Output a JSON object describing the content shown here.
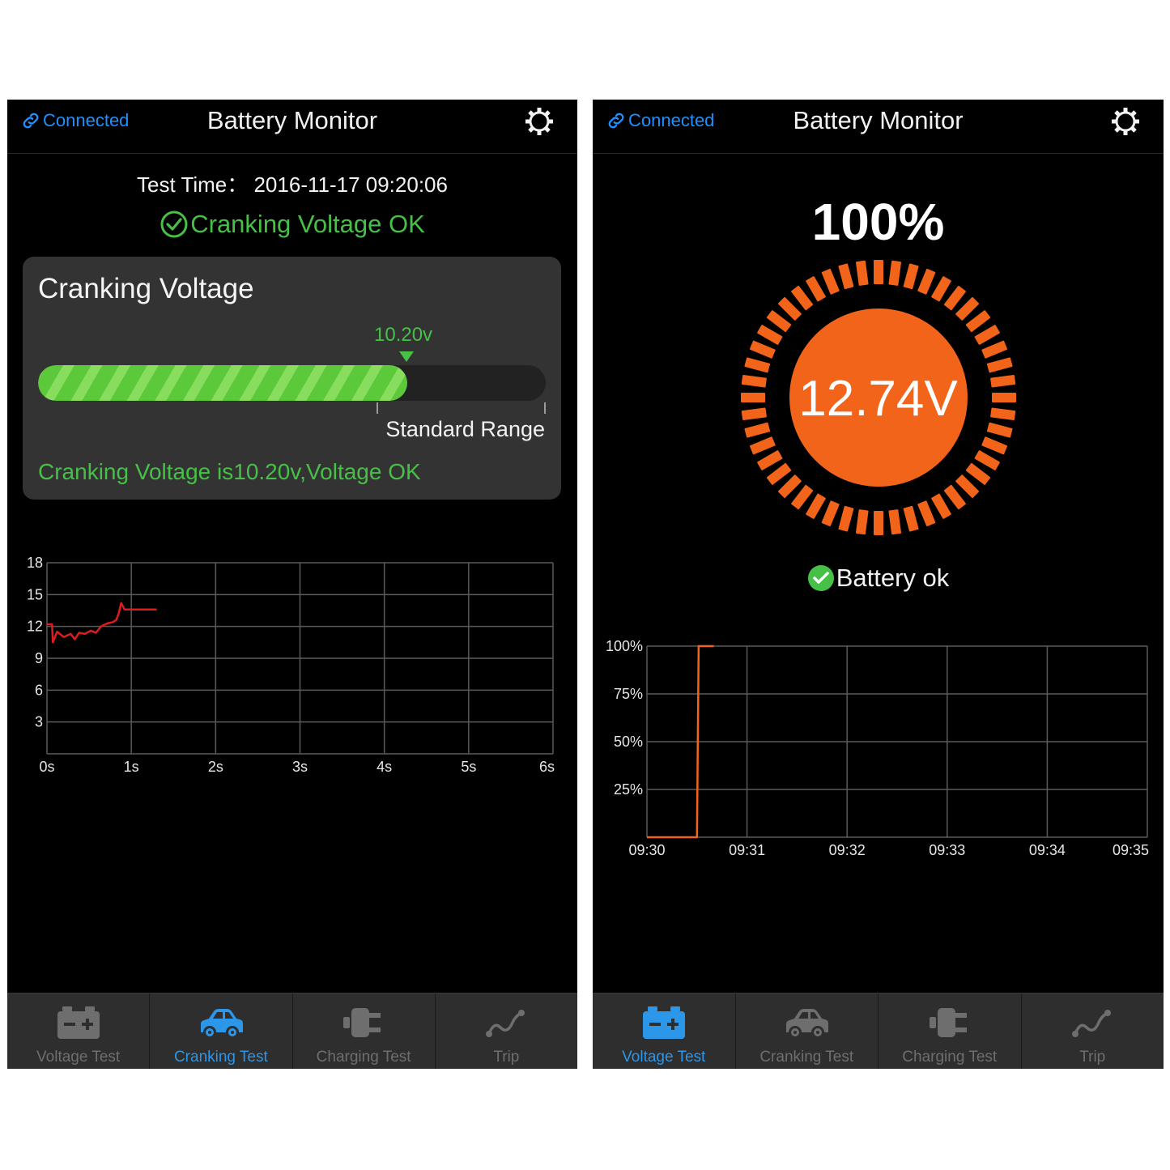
{
  "screens": [
    {
      "navbar": {
        "connected_label": "Connected",
        "title": "Battery Monitor"
      },
      "test_time": "Test Time： 2016-11-17 09:20:06",
      "status_text": "Cranking Voltage OK",
      "panel": {
        "title": "Cranking Voltage",
        "marker_value": "10.20v",
        "fill_fraction": 0.727,
        "range_label": "Standard Range",
        "message": "Cranking Voltage is10.20v,Voltage OK"
      },
      "tabs": [
        {
          "label": "Voltage Test",
          "icon": "battery-icon",
          "active": false
        },
        {
          "label": "Cranking Test",
          "icon": "car-icon",
          "active": true
        },
        {
          "label": "Charging Test",
          "icon": "plug-icon",
          "active": false
        },
        {
          "label": "Trip",
          "icon": "trip-route-icon",
          "active": false
        }
      ]
    },
    {
      "navbar": {
        "connected_label": "Connected",
        "title": "Battery Monitor"
      },
      "percent": "100%",
      "gauge_value": "12.74V",
      "gauge_level": 1.0,
      "status_text": "Battery ok",
      "tabs": [
        {
          "label": "Voltage Test",
          "icon": "battery-icon",
          "active": true
        },
        {
          "label": "Cranking Test",
          "icon": "car-icon",
          "active": false
        },
        {
          "label": "Charging Test",
          "icon": "plug-icon",
          "active": false
        },
        {
          "label": "Trip",
          "icon": "trip-route-icon",
          "active": false
        }
      ]
    }
  ],
  "colors": {
    "accent_blue": "#2c96e8",
    "ok_green": "#46c046",
    "gauge_orange": "#f26419",
    "crank_line": "#e01b1b"
  },
  "chart_data": [
    {
      "type": "line",
      "x_ticks": [
        "0s",
        "1s",
        "2s",
        "3s",
        "4s",
        "5s",
        "6s"
      ],
      "y_ticks": [
        "18",
        "15",
        "12",
        "9",
        "6",
        "3"
      ],
      "xlim": [
        0,
        6
      ],
      "ylim": [
        0,
        18
      ],
      "grid": true,
      "series": [
        {
          "color": "#e01b1b",
          "x": [
            0.0,
            0.06,
            0.07,
            0.12,
            0.2,
            0.28,
            0.33,
            0.38,
            0.45,
            0.52,
            0.58,
            0.64,
            0.72,
            0.78,
            0.82,
            0.85,
            0.88,
            0.92,
            1.0,
            1.1,
            1.3
          ],
          "y": [
            12.2,
            12.2,
            10.5,
            11.5,
            11.0,
            11.3,
            10.8,
            11.4,
            11.3,
            11.6,
            11.4,
            12.0,
            12.3,
            12.4,
            12.6,
            13.2,
            14.2,
            13.6,
            13.6,
            13.6,
            13.6
          ]
        }
      ]
    },
    {
      "type": "line",
      "x_ticks": [
        "09:30",
        "09:31",
        "09:32",
        "09:33",
        "09:34",
        "09:35"
      ],
      "y_ticks": [
        "100%",
        "75%",
        "50%",
        "25%"
      ],
      "ylim": [
        0,
        100
      ],
      "grid": true,
      "series": [
        {
          "color": "#f26419",
          "x": [
            "09:30:00",
            "09:30:30",
            "09:30:31",
            "09:30:40"
          ],
          "y": [
            0,
            0,
            100,
            100
          ]
        }
      ]
    }
  ]
}
